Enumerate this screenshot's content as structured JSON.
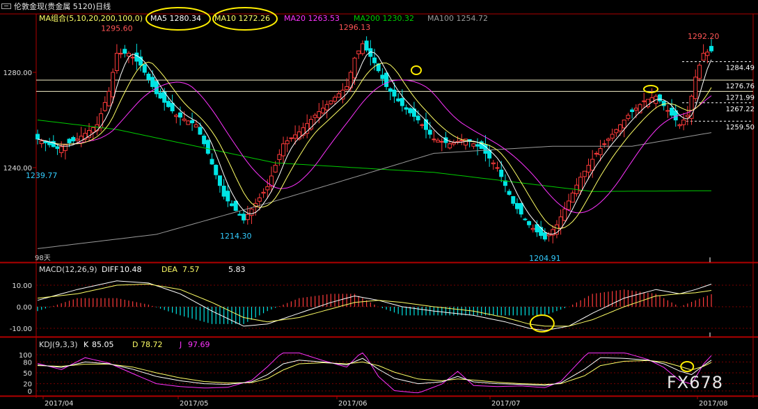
{
  "window_title": "伦敦金现(贵金属 5120)日线",
  "colors": {
    "background": "#000000",
    "up": "#ff3b3b",
    "down": "#00e5e5",
    "ma5": "#ffffff",
    "ma10": "#ffff66",
    "ma20": "#ff33ff",
    "ma200": "#00cc00",
    "ma100": "#9a9a9a",
    "axis": "#8b0000",
    "price_label": "#ff5555",
    "low_label": "#33ccff",
    "highlight": "#ffee00"
  },
  "main_legend": [
    {
      "label": "MA组合(5,10,20,200,100,0)",
      "color": "#ffff66"
    },
    {
      "label": "MA5 1280.34",
      "color": "#ffffff"
    },
    {
      "label": "MA10 1272.26",
      "color": "#ffff66"
    },
    {
      "label": "MA20 1263.53",
      "color": "#ff33ff"
    },
    {
      "label": "MA200 1230.32",
      "color": "#00cc00"
    },
    {
      "label": "MA100 1254.72",
      "color": "#9a9a9a"
    }
  ],
  "macd_legend": [
    {
      "label": "MACD(12,26,9)",
      "color": "#dddddd"
    },
    {
      "label": "DIFF",
      "color": "#ffffff"
    },
    {
      "label": "10.48",
      "color": "#ffffff"
    },
    {
      "label": "DEA",
      "color": "#ffff66"
    },
    {
      "label": "7.57",
      "color": "#ffff66"
    },
    {
      "label": "5.83",
      "color": "#ffffff"
    }
  ],
  "kdj_legend": [
    {
      "label": "KDJ(9,3,3)",
      "color": "#dddddd"
    },
    {
      "label": "K",
      "color": "#ffffff"
    },
    {
      "label": "85.05",
      "color": "#ffffff"
    },
    {
      "label": "D",
      "color": "#ffff66"
    },
    {
      "label": "78.72",
      "color": "#ffff66"
    },
    {
      "label": "J",
      "color": "#ff33ff"
    },
    {
      "label": "97.69",
      "color": "#ff33ff"
    }
  ],
  "side_note": "98天",
  "watermark": "FX678",
  "chart_data": [
    {
      "type": "candlestick",
      "title": "伦敦金现(贵金属 5120)日线",
      "x_ticks": [
        "2017/04",
        "2017/05",
        "2017/06",
        "2017/07",
        "2017/08"
      ],
      "y_ticks": [
        1280.0,
        1240.0
      ],
      "ylim": [
        1202,
        1296
      ],
      "price_lines": [
        1284.49,
        1276.76,
        1271.99,
        1267.22,
        1259.5
      ],
      "extreme_labels": [
        {
          "text": "1295.60",
          "x": 20,
          "y": 1295.6,
          "kind": "high"
        },
        {
          "text": "1296.13",
          "x": 80,
          "y": 1296.13,
          "kind": "high"
        },
        {
          "text": "1292.20",
          "x": 168,
          "y": 1292.2,
          "kind": "high"
        },
        {
          "text": "1239.77",
          "x": 1,
          "y": 1239.77,
          "kind": "low"
        },
        {
          "text": "1214.30",
          "x": 50,
          "y": 1214.3,
          "kind": "low"
        },
        {
          "text": "1204.91",
          "x": 128,
          "y": 1204.91,
          "kind": "low"
        }
      ],
      "close_anchors": [
        [
          0,
          1252
        ],
        [
          5,
          1248
        ],
        [
          10,
          1252
        ],
        [
          15,
          1258
        ],
        [
          18,
          1272
        ],
        [
          20,
          1288
        ],
        [
          23,
          1288
        ],
        [
          26,
          1283
        ],
        [
          30,
          1271
        ],
        [
          35,
          1262
        ],
        [
          40,
          1258
        ],
        [
          43,
          1246
        ],
        [
          47,
          1228
        ],
        [
          52,
          1218
        ],
        [
          55,
          1225
        ],
        [
          58,
          1232
        ],
        [
          62,
          1250
        ],
        [
          66,
          1255
        ],
        [
          70,
          1262
        ],
        [
          74,
          1268
        ],
        [
          78,
          1274
        ],
        [
          80,
          1286
        ],
        [
          82,
          1292
        ],
        [
          85,
          1284
        ],
        [
          88,
          1274
        ],
        [
          92,
          1266
        ],
        [
          96,
          1260
        ],
        [
          100,
          1252
        ],
        [
          104,
          1250
        ],
        [
          108,
          1252
        ],
        [
          112,
          1248
        ],
        [
          116,
          1240
        ],
        [
          120,
          1225
        ],
        [
          124,
          1216
        ],
        [
          128,
          1210
        ],
        [
          131,
          1216
        ],
        [
          134,
          1226
        ],
        [
          137,
          1236
        ],
        [
          141,
          1246
        ],
        [
          145,
          1254
        ],
        [
          149,
          1262
        ],
        [
          153,
          1268
        ],
        [
          156,
          1270
        ],
        [
          159,
          1264
        ],
        [
          162,
          1258
        ],
        [
          164,
          1262
        ],
        [
          166,
          1278
        ],
        [
          168,
          1288
        ],
        [
          170,
          1289
        ]
      ],
      "ma200_anchors": [
        [
          0,
          1260
        ],
        [
          20,
          1256
        ],
        [
          60,
          1242
        ],
        [
          100,
          1238
        ],
        [
          140,
          1230
        ],
        [
          170,
          1230.32
        ]
      ],
      "ma100_anchors": [
        [
          0,
          1206
        ],
        [
          30,
          1212
        ],
        [
          60,
          1226
        ],
        [
          100,
          1246
        ],
        [
          130,
          1249
        ],
        [
          150,
          1249
        ],
        [
          170,
          1254.72
        ]
      ]
    },
    {
      "type": "bar",
      "title": "MACD(12,26,9)",
      "y_ticks": [
        10.0,
        0.0,
        -10.0
      ],
      "ylim": [
        -14,
        14
      ],
      "diff_anchors": [
        [
          0,
          3
        ],
        [
          10,
          8
        ],
        [
          20,
          12
        ],
        [
          28,
          11
        ],
        [
          36,
          6
        ],
        [
          44,
          -2
        ],
        [
          52,
          -9
        ],
        [
          58,
          -8
        ],
        [
          66,
          -3
        ],
        [
          74,
          2
        ],
        [
          80,
          5
        ],
        [
          86,
          3
        ],
        [
          92,
          0
        ],
        [
          100,
          -2
        ],
        [
          110,
          -4
        ],
        [
          118,
          -7
        ],
        [
          124,
          -10
        ],
        [
          128,
          -11
        ],
        [
          134,
          -9
        ],
        [
          140,
          -3
        ],
        [
          148,
          4
        ],
        [
          156,
          8
        ],
        [
          162,
          6
        ],
        [
          166,
          8
        ],
        [
          170,
          10.48
        ]
      ],
      "dea_anchors": [
        [
          0,
          4
        ],
        [
          10,
          6
        ],
        [
          20,
          10
        ],
        [
          28,
          10.5
        ],
        [
          36,
          8
        ],
        [
          44,
          2
        ],
        [
          52,
          -5
        ],
        [
          58,
          -7
        ],
        [
          66,
          -5
        ],
        [
          74,
          -1
        ],
        [
          80,
          2
        ],
        [
          86,
          3
        ],
        [
          92,
          2
        ],
        [
          100,
          0
        ],
        [
          110,
          -2
        ],
        [
          118,
          -5
        ],
        [
          124,
          -8
        ],
        [
          128,
          -9
        ],
        [
          134,
          -9
        ],
        [
          140,
          -6
        ],
        [
          148,
          0
        ],
        [
          156,
          5
        ],
        [
          162,
          6
        ],
        [
          166,
          6.5
        ],
        [
          170,
          7.57
        ]
      ],
      "histogram_scale": 1,
      "highlight_x": 128
    },
    {
      "type": "line",
      "title": "KDJ(9,3,3)",
      "y_ticks": [
        100,
        80,
        50,
        20,
        0
      ],
      "ylim": [
        0,
        100
      ],
      "k_anchors": [
        [
          0,
          72
        ],
        [
          6,
          65
        ],
        [
          12,
          80
        ],
        [
          18,
          75
        ],
        [
          24,
          60
        ],
        [
          30,
          40
        ],
        [
          36,
          28
        ],
        [
          42,
          20
        ],
        [
          48,
          18
        ],
        [
          54,
          25
        ],
        [
          58,
          45
        ],
        [
          62,
          75
        ],
        [
          66,
          85
        ],
        [
          72,
          80
        ],
        [
          78,
          72
        ],
        [
          82,
          90
        ],
        [
          86,
          60
        ],
        [
          90,
          35
        ],
        [
          96,
          20
        ],
        [
          102,
          25
        ],
        [
          106,
          40
        ],
        [
          110,
          25
        ],
        [
          116,
          20
        ],
        [
          122,
          18
        ],
        [
          128,
          15
        ],
        [
          132,
          22
        ],
        [
          138,
          60
        ],
        [
          142,
          92
        ],
        [
          148,
          90
        ],
        [
          154,
          85
        ],
        [
          158,
          75
        ],
        [
          162,
          55
        ],
        [
          165,
          45
        ],
        [
          168,
          70
        ],
        [
          170,
          85.05
        ]
      ],
      "d_anchors": [
        [
          0,
          70
        ],
        [
          6,
          68
        ],
        [
          12,
          74
        ],
        [
          18,
          74
        ],
        [
          24,
          66
        ],
        [
          30,
          50
        ],
        [
          36,
          36
        ],
        [
          42,
          26
        ],
        [
          48,
          22
        ],
        [
          54,
          23
        ],
        [
          58,
          34
        ],
        [
          62,
          58
        ],
        [
          66,
          75
        ],
        [
          72,
          78
        ],
        [
          78,
          75
        ],
        [
          82,
          80
        ],
        [
          86,
          70
        ],
        [
          90,
          52
        ],
        [
          96,
          33
        ],
        [
          102,
          28
        ],
        [
          106,
          33
        ],
        [
          110,
          30
        ],
        [
          116,
          24
        ],
        [
          122,
          20
        ],
        [
          128,
          18
        ],
        [
          132,
          20
        ],
        [
          138,
          42
        ],
        [
          142,
          70
        ],
        [
          148,
          82
        ],
        [
          154,
          84
        ],
        [
          158,
          80
        ],
        [
          162,
          68
        ],
        [
          165,
          58
        ],
        [
          168,
          68
        ],
        [
          170,
          78.72
        ]
      ],
      "highlight_x": 166
    }
  ]
}
